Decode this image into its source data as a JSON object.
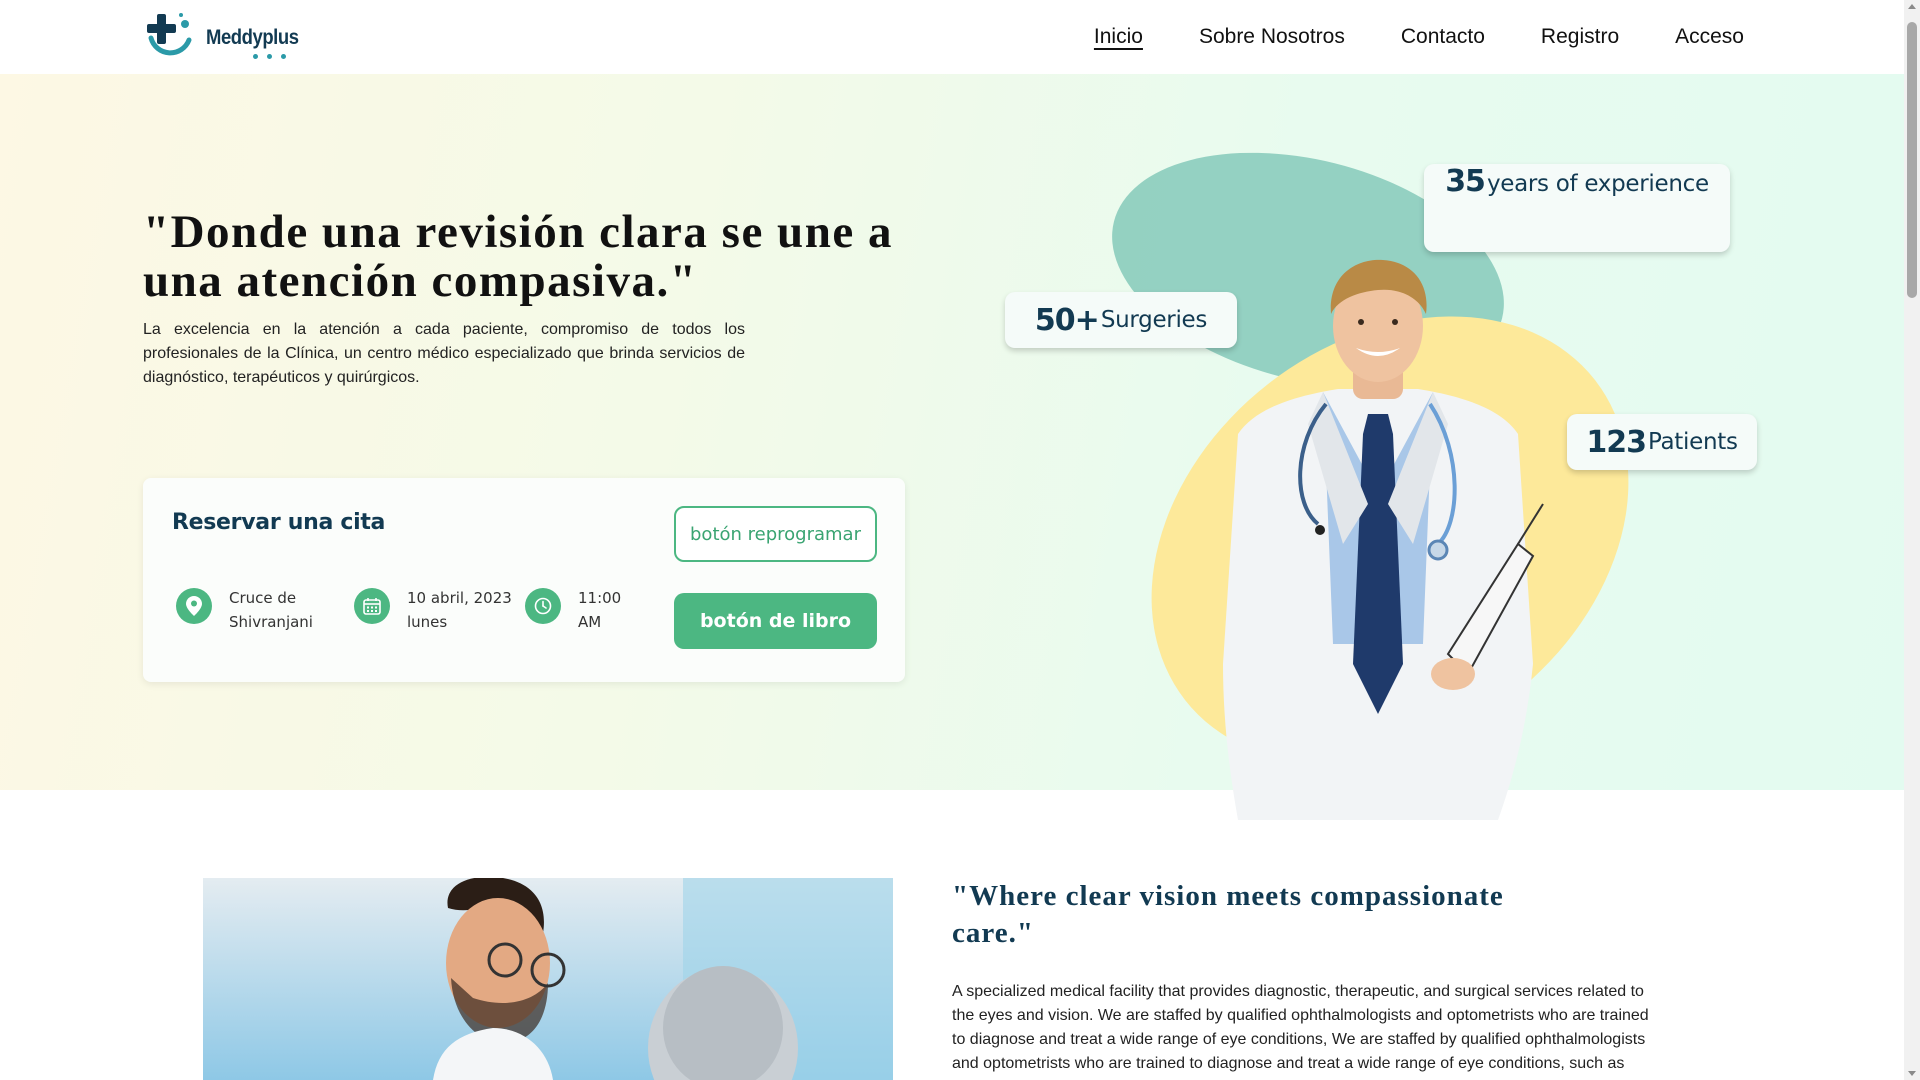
{
  "brand": {
    "name": "Meddyplus"
  },
  "nav": {
    "items": [
      {
        "label": "Inicio",
        "active": true
      },
      {
        "label": "Sobre Nosotros",
        "active": false
      },
      {
        "label": "Contacto",
        "active": false
      },
      {
        "label": "Registro",
        "active": false
      },
      {
        "label": "Acceso",
        "active": false
      }
    ]
  },
  "hero": {
    "title": "\"Donde una revisión clara se une a una atención compasiva.\"",
    "description": "La excelencia en la atención a cada paciente, compromiso de todos los profesionales de la Clínica, un centro médico especializado que brinda servicios de diagnóstico, terapéuticos y quirúrgicos."
  },
  "booking": {
    "title": "Reservar una cita",
    "location": {
      "line1": "Cruce de",
      "line2": "Shivranjani"
    },
    "date": {
      "line1": "10 abril, 2023",
      "line2": "lunes"
    },
    "time": {
      "line1": "11:00",
      "line2": "AM"
    },
    "reschedule_label": "botón reprogramar",
    "book_label": "botón de libro"
  },
  "stats": {
    "experience": {
      "number": "35",
      "label": "years of experience"
    },
    "surgeries": {
      "number": "50+",
      "label": "Surgeries"
    },
    "patients": {
      "number": "123",
      "label": "Patients"
    }
  },
  "about": {
    "title": "\"Where clear vision meets compassionate care.\"",
    "description": "A specialized medical facility that provides diagnostic, therapeutic, and surgical services related to the eyes and vision. We are staffed by qualified ophthalmologists and optometrists who are trained to diagnose and treat a wide range of eye conditions, We are staffed by qualified ophthalmologists and optometrists who are trained to diagnose and treat a wide range of eye conditions, such as"
  },
  "colors": {
    "accent": "#4cb782",
    "brand_dark": "#123a52",
    "blob_teal": "#8fcfbf",
    "blob_yellow": "#fde99a"
  },
  "icons": {
    "location": "location-pin-icon",
    "date": "calendar-icon",
    "time": "clock-icon"
  }
}
